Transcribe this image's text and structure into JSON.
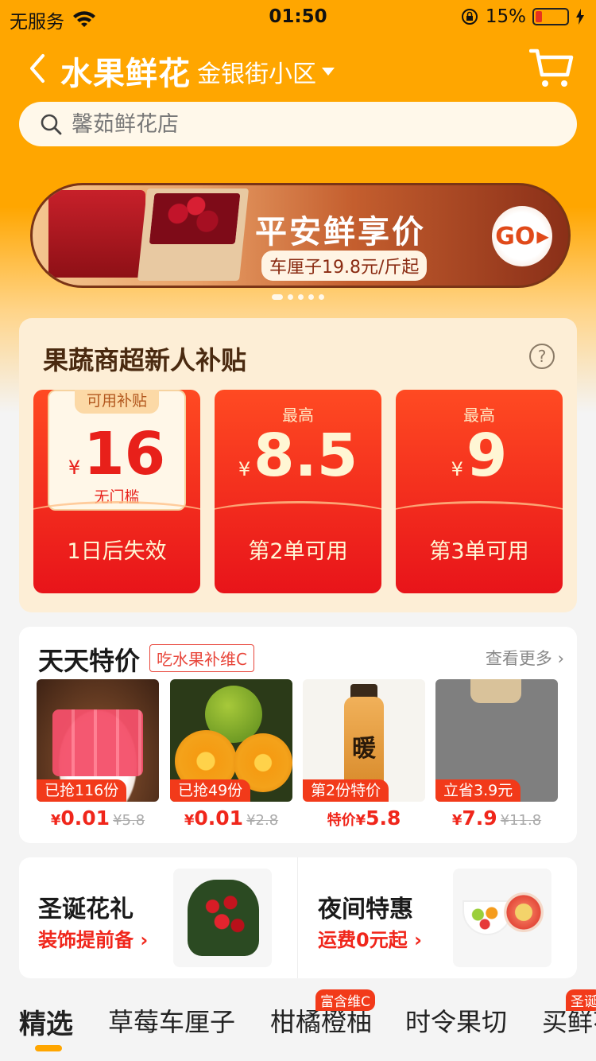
{
  "status_bar": {
    "carrier": "无服务",
    "time": "01:50",
    "battery": "15%"
  },
  "navbar": {
    "title": "水果鲜花",
    "location": "金银街小区"
  },
  "search": {
    "placeholder": "馨茹鲜花店"
  },
  "banner": {
    "title": "平安鲜享价",
    "subtitle": "车厘子19.8元/斤起",
    "go": "GO",
    "dot_count": 5,
    "active_dot": 0
  },
  "subsidy": {
    "title": "果蔬商超新人补贴",
    "coupons": [
      {
        "tag": "可用补贴",
        "currency": "¥",
        "amount": "16",
        "note": "无门槛",
        "condition": "1日后失效"
      },
      {
        "label": "最高",
        "currency": "¥",
        "amount": "8.5",
        "condition": "第2单可用"
      },
      {
        "label": "最高",
        "currency": "¥",
        "amount": "9",
        "condition": "第3单可用"
      }
    ]
  },
  "deals": {
    "title": "天天特价",
    "tag": "吃水果补维C",
    "more": "查看更多",
    "products": [
      {
        "badge": "已抢116份",
        "currency": "¥",
        "price": "0.01",
        "old_price": "¥5.8"
      },
      {
        "badge": "已抢49份",
        "currency": "¥",
        "price": "0.01",
        "old_price": "¥2.8"
      },
      {
        "badge": "第2份特价",
        "prefix": "特价",
        "currency": "¥",
        "price": "5.8",
        "bottle_label": "暖"
      },
      {
        "badge": "立省3.9元",
        "currency": "¥",
        "price": "7.9",
        "old_price": "¥11.8"
      }
    ]
  },
  "promos": [
    {
      "title": "圣诞花礼",
      "subtitle": "装饰提前备"
    },
    {
      "title": "夜间特惠",
      "subtitle": "运费0元起"
    }
  ],
  "tabs": [
    {
      "label": "精选"
    },
    {
      "label": "草莓车厘子"
    },
    {
      "label": "柑橘橙柚",
      "badge": "富含维C"
    },
    {
      "label": "时令果切"
    },
    {
      "label": "买鲜花",
      "badge": "圣诞"
    }
  ],
  "colors": {
    "brand": "#ffa600",
    "accent_red": "#f0261b"
  }
}
